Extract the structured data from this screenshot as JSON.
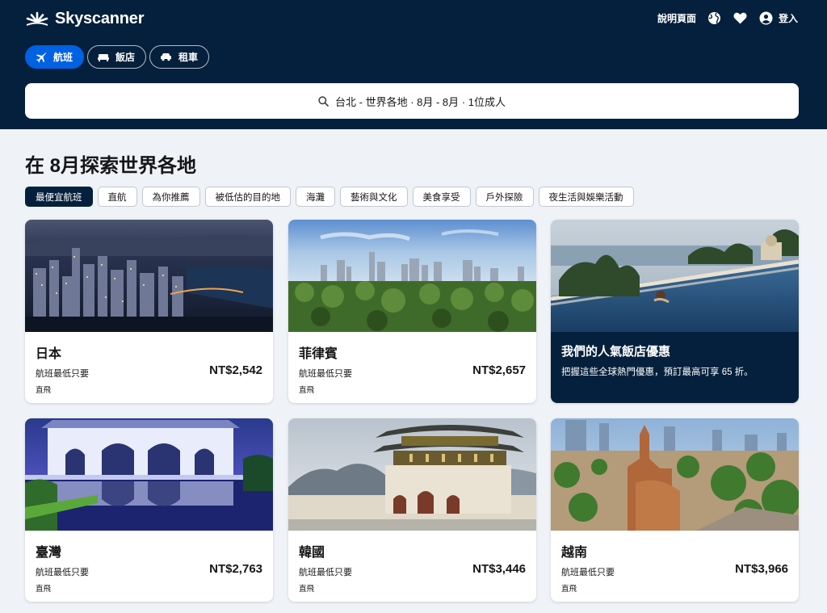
{
  "brand": {
    "name": "Skyscanner"
  },
  "header_nav": {
    "help": "說明頁面",
    "login": "登入"
  },
  "tabs": [
    {
      "label": "航班",
      "icon": "plane-icon"
    },
    {
      "label": "飯店",
      "icon": "bed-icon"
    },
    {
      "label": "租車",
      "icon": "car-icon"
    }
  ],
  "search": {
    "summary": "台北 - 世界各地 · 8月 - 8月 · 1位成人"
  },
  "page": {
    "title": "在 8月探索世界各地"
  },
  "chips": [
    "最便宜航班",
    "直航",
    "為你推薦",
    "被低估的目的地",
    "海灘",
    "藝術與文化",
    "美食享受",
    "戶外探險",
    "夜生活與娛樂活動"
  ],
  "cards": [
    {
      "name": "日本",
      "subtitle": "航班最低只要",
      "price": "NT$2,542",
      "note": "直飛"
    },
    {
      "name": "菲律賓",
      "subtitle": "航班最低只要",
      "price": "NT$2,657",
      "note": "直飛"
    },
    {
      "name": "臺灣",
      "subtitle": "航班最低只要",
      "price": "NT$2,763",
      "note": "直飛"
    },
    {
      "name": "韓國",
      "subtitle": "航班最低只要",
      "price": "NT$3,446",
      "note": "直飛"
    },
    {
      "name": "越南",
      "subtitle": "航班最低只要",
      "price": "NT$3,966",
      "note": "直飛"
    }
  ],
  "promo": {
    "title": "我們的人氣飯店優惠",
    "desc": "把握這些全球熱門優惠，預訂最高可享 65 折。"
  },
  "colors": {
    "header_bg": "#05203c",
    "accent": "#0062e3",
    "page_bg": "#eff3f8"
  }
}
